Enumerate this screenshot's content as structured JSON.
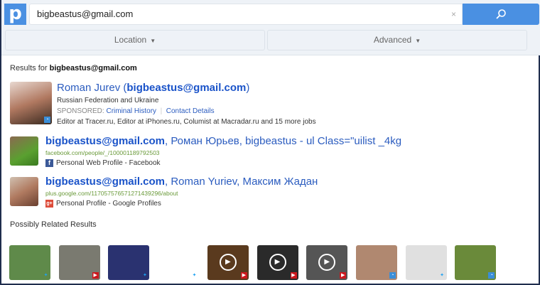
{
  "header": {
    "logo": "p",
    "search_value": "bigbeastus@gmail.com",
    "clear": "×",
    "location_label": "Location",
    "advanced_label": "Advanced"
  },
  "results_for": {
    "prefix": "Results for",
    "query": "bigbeastus@gmail.com"
  },
  "results": [
    {
      "name": "Roman Jurev (",
      "email": "bigbeastus@gmail.com",
      "close": ")",
      "location": "Russian Federation and Ukraine",
      "sponsored": "SPONSORED:",
      "link1": "Criminal History",
      "sep": "|",
      "link2": "Contact Details",
      "jobs": "Editor at Tracer.ru, Editor at iPhones.ru, Columist at Macradar.ru and 15 more jobs"
    },
    {
      "email": "bigbeastus@gmail.com",
      "rest": ", Роман Юрьев, bigbeastus - ul Class=\"uilist _4kg",
      "url": "facebook.com/people/_/100001189792503",
      "source": "Personal Web Profile - Facebook"
    },
    {
      "email": "bigbeastus@gmail.com",
      "rest": ", Roman Yuriev, Максим Жадан",
      "url": "plus.google.com/117057576571271439296/about",
      "source": "Personal Profile - Google Profiles"
    }
  ],
  "related": {
    "title": "Possibly Related Results",
    "thumbs": [
      {
        "kind": "twitter",
        "bg": "#5f8a4a"
      },
      {
        "kind": "youtube",
        "bg": "#7a7a70"
      },
      {
        "kind": "twitter",
        "bg": "#2a3270"
      },
      {
        "kind": "twitter",
        "bg": "#ffffff"
      },
      {
        "kind": "youtube",
        "bg": "#5a3a1e"
      },
      {
        "kind": "youtube",
        "bg": "#2a2a2a"
      },
      {
        "kind": "youtube",
        "bg": "#555555"
      },
      {
        "kind": "other",
        "bg": "#b08870"
      },
      {
        "kind": "twitter",
        "bg": "#e0e0e0"
      },
      {
        "kind": "other",
        "bg": "#6a8a3a"
      }
    ]
  },
  "colors": {
    "accent": "#4a90e2",
    "link": "#2b5cbf",
    "url": "#6a9a3a"
  }
}
